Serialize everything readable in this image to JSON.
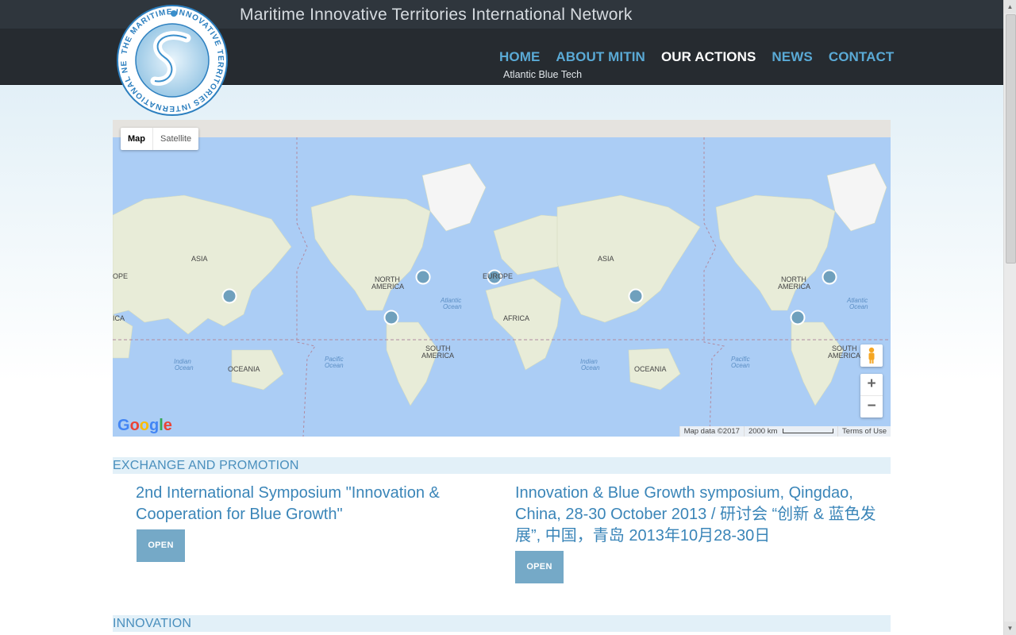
{
  "site": {
    "title": "Maritime Innovative Territories International Network",
    "logo_text": "THE MARITIME INNOVATIVE TERRITORIES INTERNATIONAL NETWORK"
  },
  "nav": {
    "items": [
      {
        "label": "HOME",
        "active": false
      },
      {
        "label": "ABOUT MITIN",
        "active": false
      },
      {
        "label": "OUR ACTIONS",
        "active": true
      },
      {
        "label": "NEWS",
        "active": false
      },
      {
        "label": "CONTACT",
        "active": false
      }
    ],
    "submenu": "Atlantic Blue Tech"
  },
  "map": {
    "type_buttons": [
      "Map",
      "Satellite"
    ],
    "selected_type": "Map",
    "labels": {
      "asia": "ASIA",
      "europe": "EUROPE",
      "europe_partial": "OPE",
      "africa": "AFRICA",
      "africa_partial": "ICA",
      "north_america": "NORTH",
      "north_america2": "AMERICA",
      "south_america": "SOUTH",
      "south_america2": "AMERICA",
      "oceania": "OCEANIA",
      "atlantic": "Atlantic",
      "atlantic2": "Ocean",
      "pacific": "Pacific",
      "pacific2": "Ocean",
      "indian": "Indian",
      "indian2": "Ocean"
    },
    "footer": {
      "map_data": "Map data ©2017",
      "scale": "2000 km",
      "terms": "Terms of Use"
    },
    "google": "Google",
    "zoom_in": "+",
    "zoom_out": "−",
    "colors": {
      "water": "#abcdf5",
      "land": "#e8ecd8",
      "marker": "#6fa0bd"
    }
  },
  "sections": [
    {
      "title": "EXCHANGE AND PROMOTION",
      "articles": [
        {
          "title": "2nd International Symposium \"Innovation & Cooperation for Blue Growth\"",
          "button": "OPEN"
        },
        {
          "title": "Innovation & Blue Growth symposium, Qingdao, China, 28-30 October 2013 / 研讨会 “创新 & 蓝色发展”, 中国，青岛 2013年10月28-30日",
          "button": "OPEN"
        }
      ]
    },
    {
      "title": "INNOVATION",
      "articles": []
    }
  ],
  "scrollbar": {
    "up": "▲",
    "down": "▼"
  }
}
